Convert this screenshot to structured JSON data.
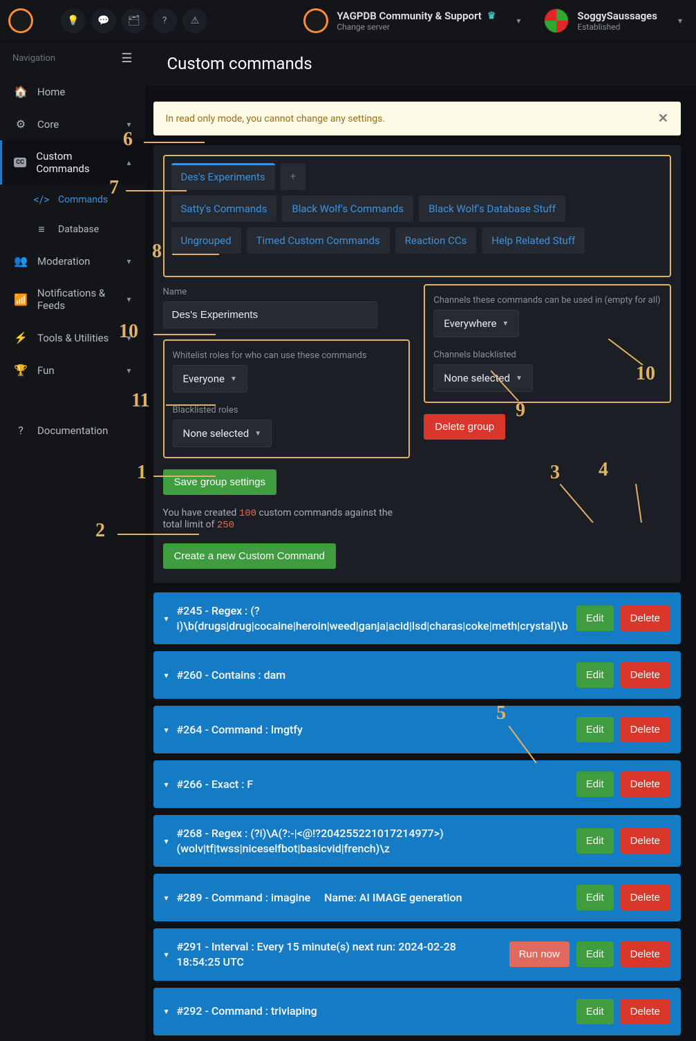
{
  "header": {
    "server_name": "YAGPDB Community & Support",
    "server_sub": "Change server",
    "user_name": "SoggySaussages",
    "user_sub": "Established"
  },
  "sidebar": {
    "nav_label": "Navigation",
    "items": {
      "home": "Home",
      "core": "Core",
      "custom_commands": "Custom Commands",
      "commands": "Commands",
      "database": "Database",
      "moderation": "Moderation",
      "notifications": "Notifications & Feeds",
      "tools": "Tools & Utilities",
      "fun": "Fun",
      "documentation": "Documentation"
    }
  },
  "page": {
    "title": "Custom commands",
    "alert": "In read only mode, you cannot change any settings."
  },
  "tabs": {
    "active": "Des's Experiments",
    "plus": "+",
    "row2": [
      "Satty's Commands",
      "Black Wolf's Commands",
      "Black Wolf's Database Stuff"
    ],
    "row3": [
      "Ungrouped",
      "Timed Custom Commands",
      "Reaction CCs",
      "Help Related Stuff"
    ]
  },
  "group": {
    "name_label": "Name",
    "name_value": "Des's Experiments",
    "whitelist_label": "Whitelist roles for who can use these commands",
    "whitelist_value": "Everyone",
    "blacklist_label": "Blacklisted roles",
    "blacklist_value": "None selected",
    "channels_label": "Channels these commands can be used in (empty for all)",
    "channels_value": "Everywhere",
    "channels_bl_label": "Channels blacklisted",
    "channels_bl_value": "None selected",
    "delete_btn": "Delete group",
    "save_btn": "Save group settings",
    "counts_prefix": "You have created ",
    "counts_current": "100",
    "counts_mid": " custom commands against the total limit of ",
    "counts_limit": "250",
    "create_btn": "Create a new Custom Command"
  },
  "buttons": {
    "edit": "Edit",
    "delete": "Delete",
    "run_now": "Run now"
  },
  "commands": [
    {
      "text": "#245 - Regex : (?i)\\b(drugs|drug|cocaine|heroin|weed|ganja|acid|lsd|charas|coke|meth|crystal)\\b",
      "run": false
    },
    {
      "text": "#260 - Contains : dam",
      "run": false
    },
    {
      "text": "#264 - Command : lmgtfy",
      "run": false
    },
    {
      "text": "#266 - Exact : F",
      "run": false
    },
    {
      "text": "#268 - Regex : (?i)\\A(?:-|<@!?204255221017214977>)(wolv|tf|twss|niceselfbot|basicvid|french)\\z",
      "run": false
    },
    {
      "text": "#289 - Command : imagine     Name: AI IMAGE generation",
      "run": false
    },
    {
      "text": "#291 - Interval : Every 15 minute(s) next run: 2024-02-28 18:54:25 UTC",
      "run": true
    },
    {
      "text": "#292 - Command : triviaping",
      "run": false
    }
  ],
  "annotations": {
    "n1": "1",
    "n2": "2",
    "n3": "3",
    "n4": "4",
    "n5": "5",
    "n6": "6",
    "n7": "7",
    "n8": "8",
    "n9": "9",
    "n10": "10",
    "n11": "11"
  }
}
